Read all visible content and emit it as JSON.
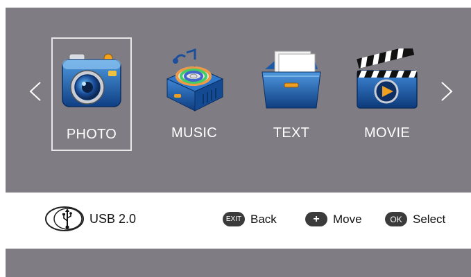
{
  "menu": {
    "items": [
      {
        "label": "PHOTO",
        "icon": "camera-icon",
        "selected": true
      },
      {
        "label": "MUSIC",
        "icon": "music-player-icon",
        "selected": false
      },
      {
        "label": "TEXT",
        "icon": "folder-icon",
        "selected": false
      },
      {
        "label": "MOVIE",
        "icon": "clapperboard-icon",
        "selected": false
      }
    ],
    "prev_arrow": "<",
    "next_arrow": ">"
  },
  "status": {
    "source_label": "USB 2.0",
    "hints": [
      {
        "key": "EXIT",
        "action": "Back"
      },
      {
        "key": "+",
        "action": "Move"
      },
      {
        "key": "OK",
        "action": "Select"
      }
    ]
  },
  "colors": {
    "panel": "#7f7d83",
    "accent_blue": "#1f5fa8",
    "selection_border": "#e7e7e7"
  }
}
